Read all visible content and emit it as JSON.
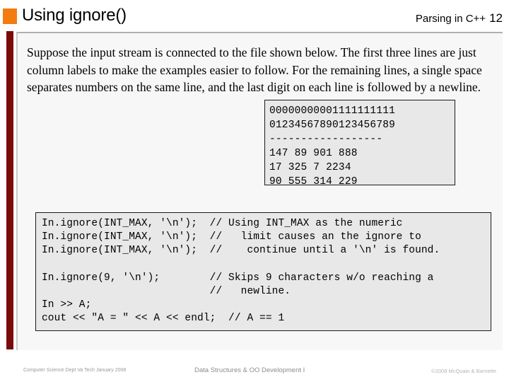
{
  "header": {
    "title": "Using ignore()",
    "course": "Parsing in C++",
    "page_number": "12",
    "bullet_color": "#F47B10"
  },
  "accent": {
    "left_bar_color": "#7B0B0B",
    "panel_background": "#F7F7F7"
  },
  "body": {
    "paragraph": "Suppose the input stream is connected to the file shown below.  The first three lines are just column labels to make the examples easier to follow.  For the remaining lines, a single space separates numbers on the same line, and the last digit on each line is followed by a newline."
  },
  "file_sample": {
    "lines": [
      "00000000001111111111",
      "01234567890123456789",
      "------------------",
      "147 89 901 888",
      "17 325 7 2234",
      "90 555 314 229"
    ]
  },
  "code_sample": {
    "lines": [
      "In.ignore(INT_MAX, '\\n');  // Using INT_MAX as the numeric",
      "In.ignore(INT_MAX, '\\n');  //   limit causes an the ignore to",
      "In.ignore(INT_MAX, '\\n');  //    continue until a '\\n' is found.",
      "",
      "In.ignore(9, '\\n');        // Skips 9 characters w/o reaching a",
      "                           //   newline.",
      "In >> A;",
      "cout << \"A = \" << A << endl;  // A == 1"
    ]
  },
  "footer": {
    "left": "Computer Science Dept Va Tech January 2008",
    "center": "Data Structures & OO Development I",
    "right": "©2008  McQuain & Barnette"
  }
}
